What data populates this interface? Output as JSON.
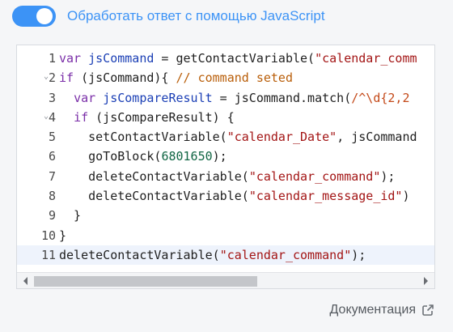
{
  "toggle": {
    "state": "on",
    "label": "Обработать ответ с помощью JavaScript",
    "color": "#3c93f6"
  },
  "editor": {
    "active_line": 11,
    "lines": [
      {
        "num": "1"
      },
      {
        "num": "2",
        "fold": true
      },
      {
        "num": "3"
      },
      {
        "num": "4",
        "fold": true
      },
      {
        "num": "5"
      },
      {
        "num": "6"
      },
      {
        "num": "7"
      },
      {
        "num": "8"
      },
      {
        "num": "9"
      },
      {
        "num": "10"
      },
      {
        "num": "11"
      }
    ],
    "tokens": {
      "l1_var": "var",
      "l1_name": "jsCommand",
      "l1_rest": " = getContactVariable(",
      "l1_str": "\"calendar_comm",
      "l2_if": "if",
      "l2_rest": " (jsCommand){ ",
      "l2_cmt": "// command seted",
      "l3_indent": "  ",
      "l3_var": "var",
      "l3_name": "jsCompareResult",
      "l3_rest": " = jsCommand.match(",
      "l3_re": "/^\\d{2,2",
      "l4_indent": "  ",
      "l4_if": "if",
      "l4_rest": " (jsCompareResult) {",
      "l5_fn": "    setContactVariable(",
      "l5_str": "\"calendar_Date\"",
      "l5_rest": ", jsCommand",
      "l6_fn": "    goToBlock(",
      "l6_num": "6801650",
      "l6_end": ");",
      "l7_fn": "    deleteContactVariable(",
      "l7_str": "\"calendar_command\"",
      "l7_end": ");",
      "l8_fn": "    deleteContactVariable(",
      "l8_str": "\"calendar_message_id\"",
      "l8_end": ")",
      "l9": "  }",
      "l10": "}",
      "l11_fn": "deleteContactVariable(",
      "l11_str": "\"calendar_command\"",
      "l11_end": ");"
    }
  },
  "scrollbar": {
    "position_fraction": 0.0,
    "visible_fraction": 0.57
  },
  "docs_link": {
    "label": "Документация",
    "icon": "external-link-icon"
  }
}
